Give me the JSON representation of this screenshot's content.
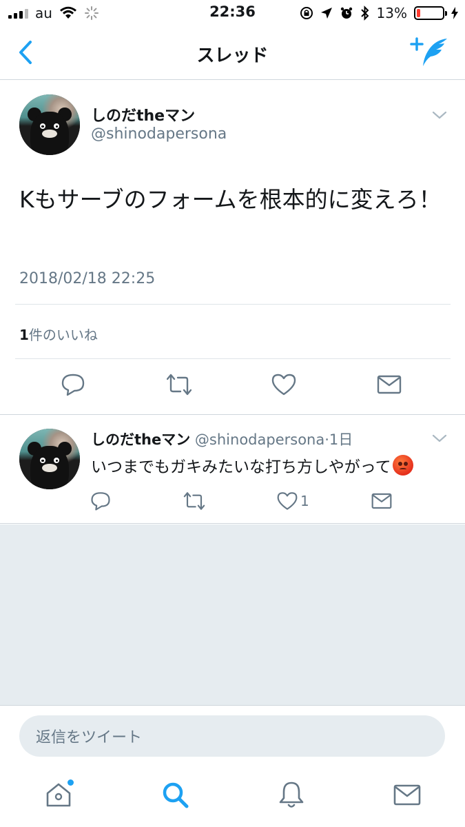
{
  "status_bar": {
    "carrier": "au",
    "time": "22:36",
    "battery": "13%",
    "battery_level": 0.13
  },
  "nav": {
    "title": "スレッド"
  },
  "main_tweet": {
    "display_name": "しのだtheマン",
    "handle": "@shinodapersona",
    "text": "Kもサーブのフォームを根本的に変えろ！",
    "timestamp": "2018/02/18 22:25",
    "like_count": "1",
    "like_label": "件のいいね"
  },
  "reply_tweet": {
    "display_name": "しのだtheマン",
    "handle": "@shinodapersona",
    "separator": "·",
    "time": "1日",
    "text": "いつまでもガキみたいな打ち方しやがって",
    "like_count": "1"
  },
  "composer": {
    "placeholder": "返信をツイート"
  },
  "colors": {
    "accent": "#1da1f2",
    "secondary_text": "#657786",
    "background_gray": "#e6ecf0"
  }
}
